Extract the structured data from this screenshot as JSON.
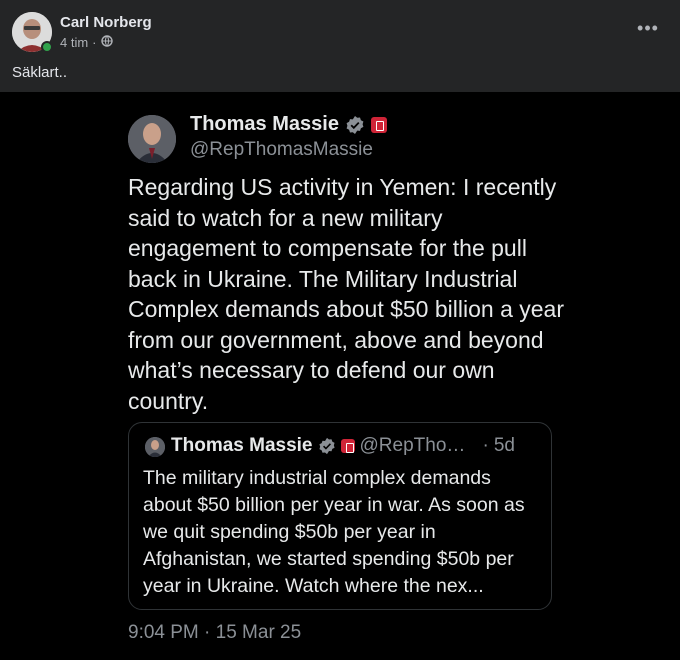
{
  "post": {
    "author": "Carl Norberg",
    "time": "4 tim",
    "separator": "·",
    "privacy_icon": "globe-icon",
    "text": "Säklart..",
    "more_label": "•••"
  },
  "tweet": {
    "name": "Thomas Massie",
    "handle": "@RepThomasMassie",
    "body": "Regarding US activity in Yemen: I recently said to watch for a new military engagement to compensate for the pull back in Ukraine. The Military Industrial Complex demands about $50 billion a year from our government, above and beyond what’s necessary to defend our own country.",
    "timestamp": "9:04 PM · 15 Mar 25",
    "quote": {
      "name": "Thomas Massie",
      "handle": "@RepThom...",
      "separator": "·",
      "age": "5d",
      "body": "The military industrial complex demands about $50 billion per year in war. As soon as we quit spending $50b per year in Afghanistan, we started spending $50b per year in Ukraine. Watch where the nex..."
    }
  },
  "colors": {
    "background": "#242526",
    "image_background": "#000000",
    "verified_blue": "#1d9bf0",
    "house_badge": "#cf2437",
    "online_green": "#31a24c"
  }
}
